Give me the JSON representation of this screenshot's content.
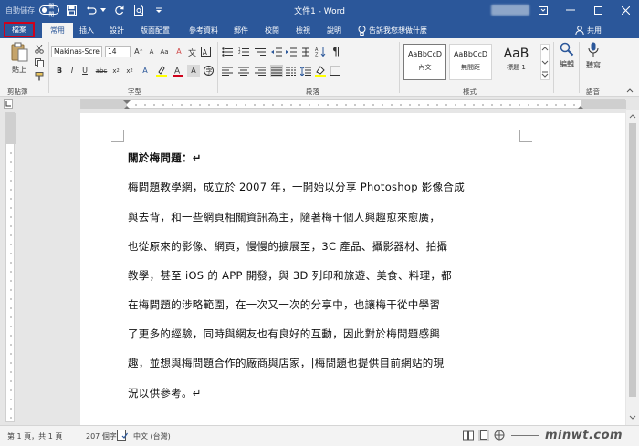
{
  "qat": {
    "autosave_label": "自動儲存",
    "toggle_label": "關閉"
  },
  "window": {
    "title": "文件1 - Word"
  },
  "tabs": [
    "檔案",
    "常用",
    "插入",
    "設計",
    "版面配置",
    "參考資料",
    "郵件",
    "校閱",
    "檢視",
    "說明"
  ],
  "tell_me": "告訴我您想做什麼",
  "share_label": "共用",
  "ribbon": {
    "paste_label": "貼上",
    "font_name": "Makinas-Scre",
    "font_size": "14",
    "styles": [
      {
        "sample": "AaBbCcD",
        "name": "內文"
      },
      {
        "sample": "AaBbCcD",
        "name": "無間距"
      },
      {
        "sample": "AaB",
        "name": "標題 1"
      }
    ],
    "edit_label": "編輯",
    "dictate_label": "聽寫",
    "groups": {
      "clipboard": "剪貼簿",
      "font": "字型",
      "paragraph": "段落",
      "styles": "樣式",
      "voice": "語音"
    }
  },
  "document": {
    "lines": [
      "關於梅問題：↵",
      "梅問題教學網，成立於 2007 年，一開始以分享 Photoshop 影像合成",
      "與去背，和一些網頁相關資訊為主，隨著梅干個人興趣愈來愈廣，",
      "也從原來的影像、網頁，慢慢的擴展至，3C 產品、攝影器材、拍攝",
      "教學，甚至 iOS 的 APP 開發，與 3D 列印和旅遊、美食、料理，都",
      "在梅問題的涉略範圍，在一次又一次的分享中，也讓梅干從中學習",
      "了更多的經驗，同時與網友也有良好的互動，因此對於梅問題感興",
      "趣，並想與梅問題合作的廠商與店家，|梅問題也提供目前網站的現",
      "況以供參考。↵"
    ]
  },
  "status": {
    "page": "第 1 頁，共 1 頁",
    "words": "207 個字",
    "language": "中文 (台灣)"
  },
  "watermark": "minwt.com",
  "colors": {
    "accent": "#2b579a",
    "highlight": "#d0021b"
  }
}
